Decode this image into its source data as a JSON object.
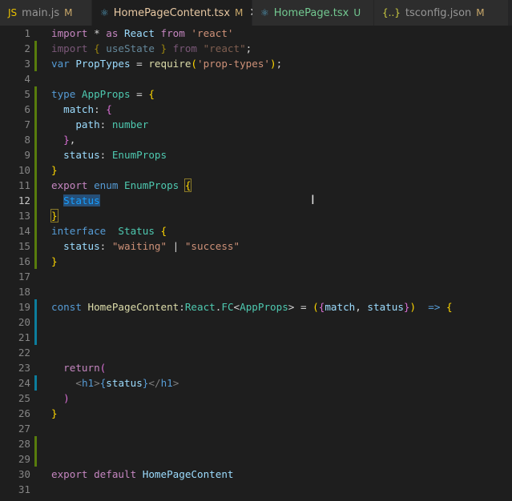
{
  "tabs": [
    {
      "icon": "JS",
      "label": "main.js",
      "status": "M",
      "active": false
    },
    {
      "icon": "⚛",
      "label": "HomePageContent.tsx",
      "status": "M",
      "active": true
    },
    {
      "icon": "⚛",
      "label": "HomePage.tsx",
      "status": "U",
      "active": false
    },
    {
      "icon": "{..}",
      "label": "tsconfig.json",
      "status": "M",
      "active": false
    }
  ],
  "close_label": "✕",
  "current_line": 12,
  "gutter": {
    "2": "g",
    "3": "g",
    "5": "g",
    "6": "g",
    "7": "g",
    "8": "g",
    "9": "g",
    "10": "g",
    "11": "g",
    "12": "g",
    "13": "g",
    "14": "g",
    "15": "g",
    "16": "g",
    "19": "b",
    "20": "b",
    "21": "b",
    "24": "b",
    "28": "g",
    "29": "g"
  },
  "lines": [
    [
      [
        "import",
        "ctl"
      ],
      [
        " * ",
        "p"
      ],
      [
        "as",
        "ctl"
      ],
      [
        " React ",
        "var"
      ],
      [
        "from",
        "ctl"
      ],
      [
        " 'react'",
        "str"
      ]
    ],
    [
      [
        "import ",
        "ctl dim"
      ],
      [
        "{",
        "b1 dim"
      ],
      [
        " useState ",
        "var dim"
      ],
      [
        "}",
        "b1 dim"
      ],
      [
        " from ",
        "ctl dim"
      ],
      [
        "\"react\"",
        "str dim"
      ],
      [
        ";",
        "p"
      ]
    ],
    [
      [
        "var",
        "kw"
      ],
      [
        " PropTypes ",
        "var"
      ],
      [
        "= ",
        "p"
      ],
      [
        "require",
        "fn"
      ],
      [
        "(",
        "b1"
      ],
      [
        "'prop-types'",
        "str"
      ],
      [
        ")",
        "b1"
      ],
      [
        ";",
        "p"
      ]
    ],
    [],
    [
      [
        "type",
        "kw"
      ],
      [
        " AppProps ",
        "ty"
      ],
      [
        "= ",
        "p"
      ],
      [
        "{",
        "b1"
      ]
    ],
    [
      [
        "  match",
        "var"
      ],
      [
        ": ",
        "p"
      ],
      [
        "{",
        "b2"
      ]
    ],
    [
      [
        "    path",
        "var"
      ],
      [
        ": ",
        "p"
      ],
      [
        "number",
        "ty"
      ]
    ],
    [
      [
        "  }",
        "b2"
      ],
      [
        ",",
        "p"
      ]
    ],
    [
      [
        "  status",
        "var"
      ],
      [
        ": ",
        "p"
      ],
      [
        "EnumProps",
        "ty"
      ]
    ],
    [
      [
        "}",
        "b1"
      ]
    ],
    [
      [
        "export",
        "ctl"
      ],
      [
        " enum",
        "kw"
      ],
      [
        " EnumProps ",
        "ty"
      ],
      [
        "{",
        "b1 box"
      ]
    ],
    [
      [
        "  ",
        "p"
      ],
      [
        "Status",
        "b3 sel"
      ]
    ],
    [
      [
        "}",
        "b1 box"
      ]
    ],
    [
      [
        "interface",
        "kw"
      ],
      [
        "  Status ",
        "ty"
      ],
      [
        "{",
        "b1"
      ]
    ],
    [
      [
        "  status",
        "var"
      ],
      [
        ": ",
        "p"
      ],
      [
        "\"waiting\"",
        "str"
      ],
      [
        " | ",
        "p"
      ],
      [
        "\"success\"",
        "str"
      ]
    ],
    [
      [
        "}",
        "b1"
      ]
    ],
    [],
    [],
    [
      [
        "const",
        "kw"
      ],
      [
        " HomePageContent",
        "fn"
      ],
      [
        ":",
        "p"
      ],
      [
        "React",
        "ty"
      ],
      [
        ".",
        "p"
      ],
      [
        "FC",
        "ty"
      ],
      [
        "<",
        "p"
      ],
      [
        "AppProps",
        "ty"
      ],
      [
        "> = ",
        "p"
      ],
      [
        "(",
        "b1"
      ],
      [
        "{",
        "b2"
      ],
      [
        "match",
        "var"
      ],
      [
        ", ",
        "p"
      ],
      [
        "status",
        "var"
      ],
      [
        "}",
        "b2"
      ],
      [
        ")",
        "b1"
      ],
      [
        "  => ",
        "kw"
      ],
      [
        "{",
        "b1"
      ]
    ],
    [],
    [],
    [],
    [
      [
        "  return",
        "ctl"
      ],
      [
        "(",
        "b2"
      ]
    ],
    [
      [
        "    ",
        "p"
      ],
      [
        "<",
        "tag"
      ],
      [
        "h1",
        "kw"
      ],
      [
        ">",
        "tag"
      ],
      [
        "{",
        "kw"
      ],
      [
        "status",
        "var"
      ],
      [
        "}",
        "kw"
      ],
      [
        "</",
        "tag"
      ],
      [
        "h1",
        "kw"
      ],
      [
        ">",
        "tag"
      ]
    ],
    [
      [
        "  )",
        "b2"
      ]
    ],
    [
      [
        "}",
        "b1"
      ]
    ],
    [],
    [],
    [],
    [
      [
        "export",
        "ctl"
      ],
      [
        " default",
        "ctl"
      ],
      [
        " HomePageContent",
        "var"
      ]
    ],
    []
  ]
}
